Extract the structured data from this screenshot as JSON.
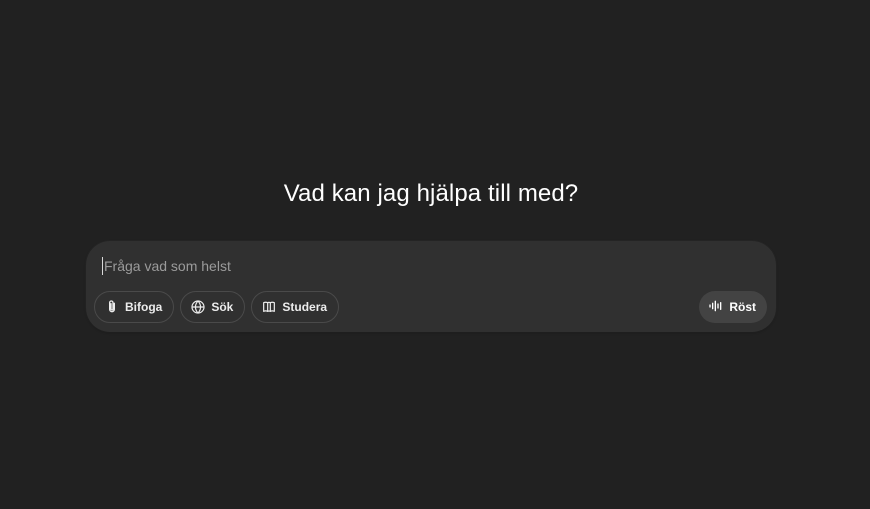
{
  "heading": "Vad kan jag hjälpa till med?",
  "composer": {
    "placeholder": "Fråga vad som helst",
    "value": ""
  },
  "tools": {
    "attach": {
      "label": "Bifoga",
      "icon": "paperclip-icon"
    },
    "search": {
      "label": "Sök",
      "icon": "globe-icon"
    },
    "study": {
      "label": "Studera",
      "icon": "book-icon"
    }
  },
  "voice": {
    "label": "Röst",
    "icon": "waveform-icon"
  },
  "colors": {
    "background": "#212121",
    "composer": "#303030",
    "pill_border": "#4a4a4a",
    "voice_button": "#434343",
    "text": "#ececec",
    "placeholder": "#9b9b9b"
  }
}
